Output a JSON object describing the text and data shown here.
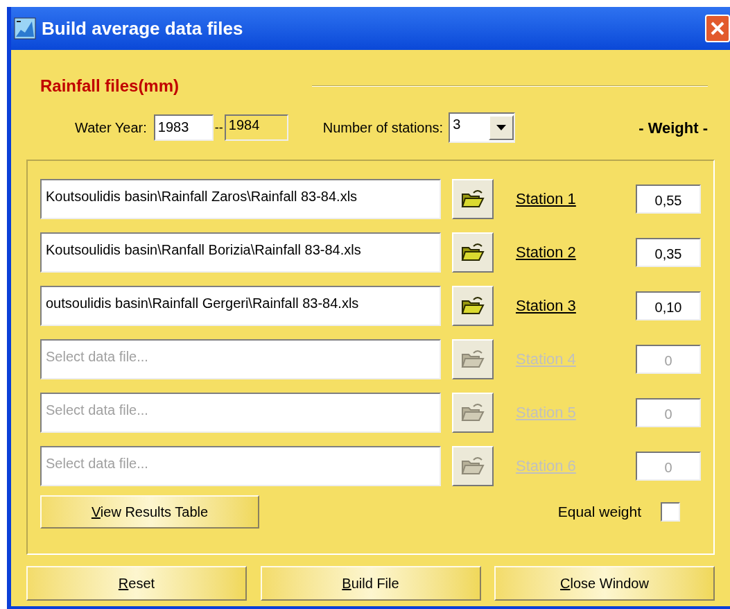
{
  "window": {
    "title": "Build average data files"
  },
  "section_title": "Rainfall files(mm)",
  "water_year": {
    "label": "Water Year:",
    "from": "1983",
    "separator": "--",
    "to": "1984"
  },
  "stations_count": {
    "label": "Number of stations:",
    "value": "3"
  },
  "weight_heading": "- Weight -",
  "stations": [
    {
      "file": "Koutsoulidis basin\\Rainfall Zaros\\Rainfall 83-84.xls",
      "label": "Station 1",
      "weight": "0,55",
      "disabled": false
    },
    {
      "file": "Koutsoulidis basin\\Ranfall Borizia\\Rainfall 83-84.xls",
      "label": "Station 2",
      "weight": "0,35",
      "disabled": false
    },
    {
      "file": "outsoulidis basin\\Rainfall Gergeri\\Rainfall 83-84.xls",
      "label": "Station 3",
      "weight": "0,10",
      "disabled": false
    },
    {
      "placeholder": "Select data file...",
      "label": "Station 4",
      "weight": "0",
      "disabled": true
    },
    {
      "placeholder": "Select data file...",
      "label": "Station 5",
      "weight": "0",
      "disabled": true
    },
    {
      "placeholder": "Select data file...",
      "label": "Station 6",
      "weight": "0",
      "disabled": true
    }
  ],
  "view_button": {
    "label": "View Results Table",
    "underlined_first_letter": true
  },
  "equal_weight": {
    "label": "Equal weight",
    "checked": false
  },
  "buttons": [
    {
      "label": "Reset",
      "underlined_first_letter": true
    },
    {
      "label": "Build File",
      "underlined_first_letter": true
    },
    {
      "label": "Close Window",
      "underlined_first_letter": true
    }
  ]
}
